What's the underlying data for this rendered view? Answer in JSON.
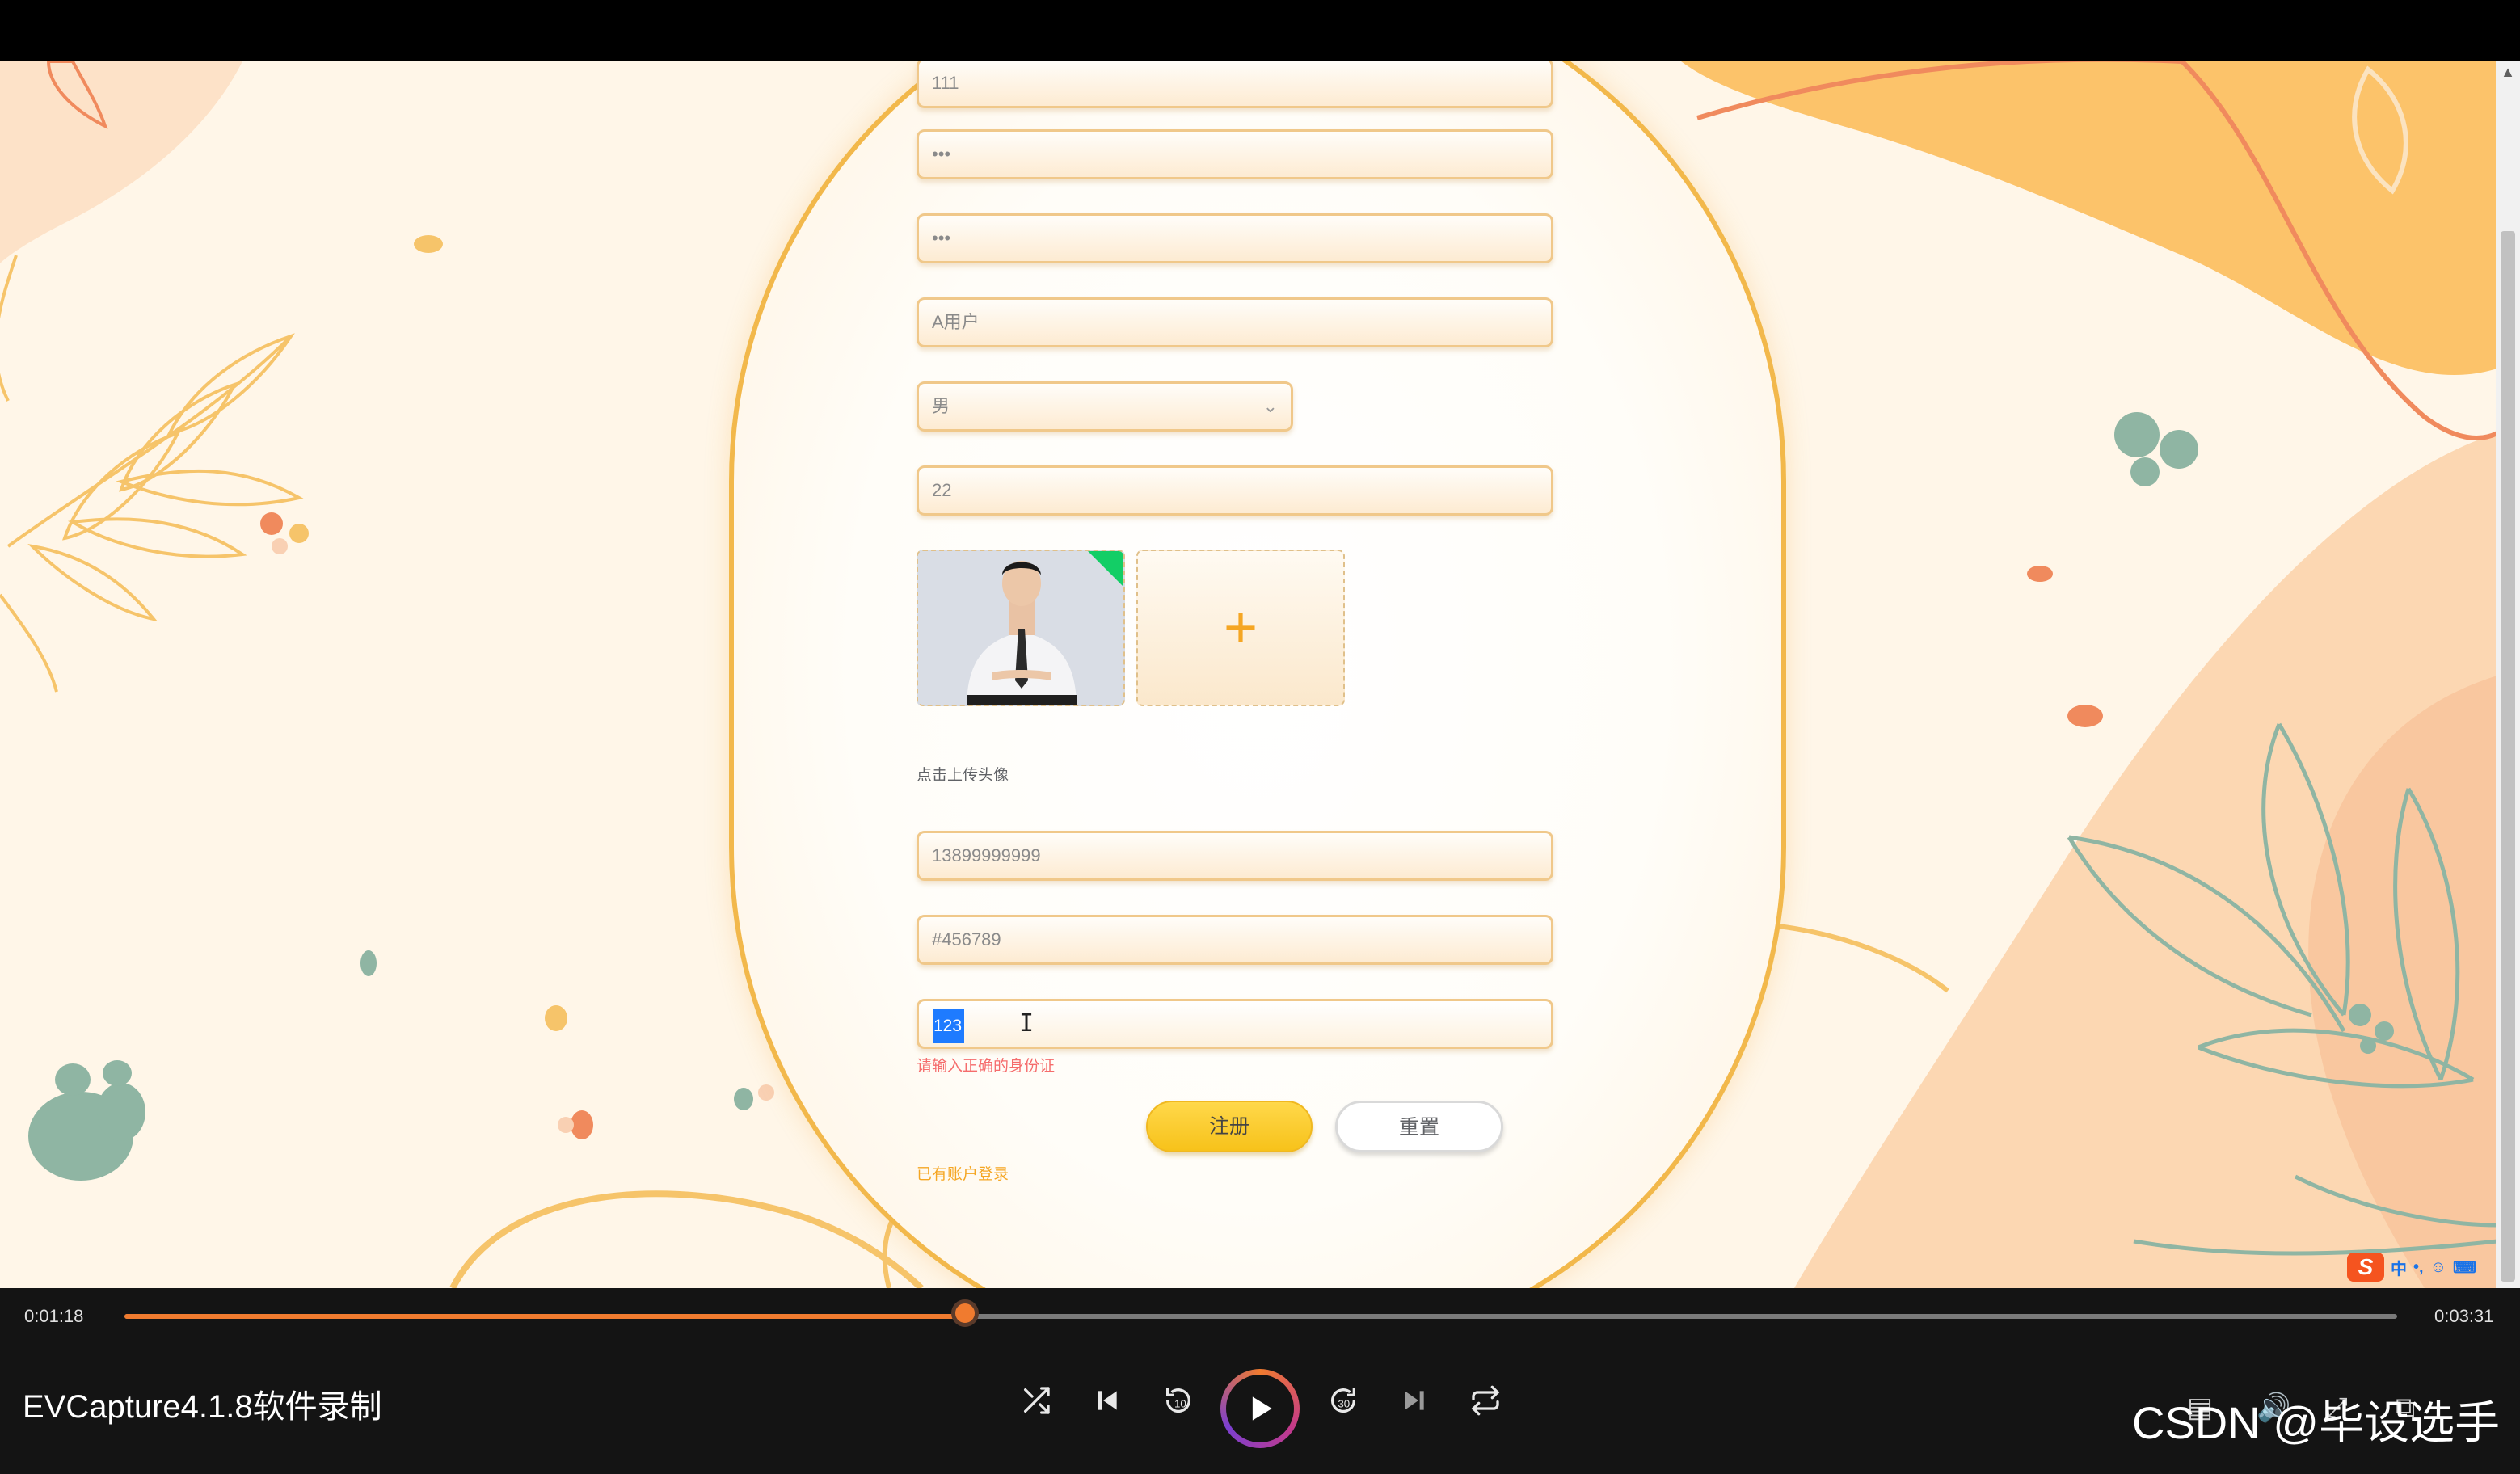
{
  "form": {
    "username": "111",
    "password": "•••",
    "confirm_password": "•••",
    "name": "A用户",
    "gender": "男",
    "age": "22",
    "upload_hint": "点击上传头像",
    "phone": "13899999999",
    "email": "#456789",
    "id_card_selected": "123",
    "id_card_error": "请输入正确的身份证",
    "register_label": "注册",
    "reset_label": "重置",
    "login_link": "已有账户登录",
    "add_photo_symbol": "+"
  },
  "ime": {
    "logo": "S",
    "lang": "中",
    "punct": "•,",
    "emoji": "☺",
    "keyboard": "⌨"
  },
  "player": {
    "current_time": "0:01:18",
    "total_time": "0:03:31",
    "progress_fraction": 0.37,
    "title": "EVCapture4.1.8软件录制",
    "watermark": "CSDN @毕设选手"
  },
  "colors": {
    "accent_orange": "#f07b2f",
    "button_yellow": "#f7c21a",
    "error_red": "#f56c6c",
    "upload_badge_green": "#13ce66"
  },
  "icons": {
    "shuffle": "shuffle-icon",
    "previous": "skip-previous-icon",
    "rewind": "rewind-10-icon",
    "play": "play-icon",
    "forward": "forward-30-icon",
    "next": "skip-next-icon",
    "repeat": "repeat-icon",
    "subtitles": "subtitles-icon",
    "volume": "volume-icon",
    "expand": "expand-icon",
    "miniplayer": "miniplayer-icon"
  }
}
